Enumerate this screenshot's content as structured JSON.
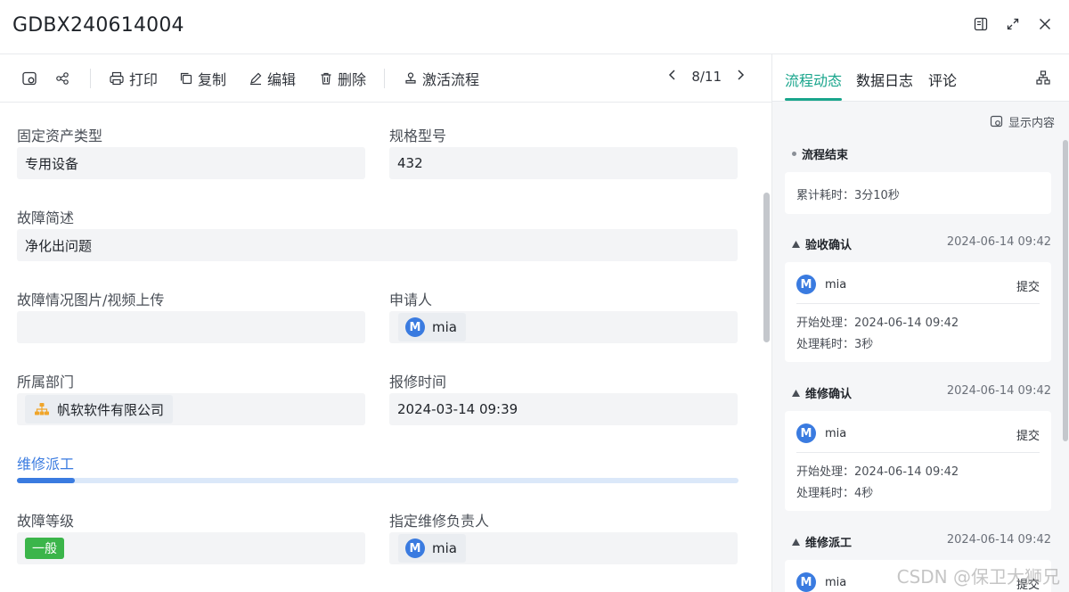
{
  "window": {
    "title": "GDBX240614004",
    "actions": [
      "sidebar-toggle",
      "expand",
      "close"
    ]
  },
  "toolbar": {
    "print": "打印",
    "copy": "复制",
    "edit": "编辑",
    "delete": "删除",
    "activate": "激活流程",
    "pager": "8/11"
  },
  "form": {
    "asset_type": {
      "label": "固定资产类型",
      "value": "专用设备"
    },
    "spec": {
      "label": "规格型号",
      "value": "432"
    },
    "fault_desc": {
      "label": "故障简述",
      "value": "净化出问题"
    },
    "upload": {
      "label": "故障情况图片/视频上传",
      "value": ""
    },
    "applicant": {
      "label": "申请人",
      "avatar": "M",
      "value": "mia"
    },
    "department": {
      "label": "所属部门",
      "value": "帆软软件有限公司"
    },
    "report_time": {
      "label": "报修时间",
      "value": "2024-03-14 09:39"
    },
    "section": {
      "title": "维修派工",
      "progress": 0.08
    },
    "fault_level": {
      "label": "故障等级",
      "value": "一般"
    },
    "assignee": {
      "label": "指定维修负责人",
      "avatar": "M",
      "value": "mia"
    }
  },
  "panel": {
    "tabs": [
      "流程动态",
      "数据日志",
      "评论"
    ],
    "active_tab": 0,
    "show_content": "显示内容",
    "end_node": {
      "title": "流程结束",
      "elapsed": "累计耗时：3分10秒"
    },
    "nodes": [
      {
        "title": "验收确认",
        "date": "2024-06-14 09:42",
        "user": "mia",
        "avatar": "M",
        "action": "提交",
        "start": "开始处理：2024-06-14 09:42",
        "cost": "处理耗时：3秒"
      },
      {
        "title": "维修确认",
        "date": "2024-06-14 09:42",
        "user": "mia",
        "avatar": "M",
        "action": "提交",
        "start": "开始处理：2024-06-14 09:42",
        "cost": "处理耗时：4秒"
      },
      {
        "title": "维修派工",
        "date": "2024-06-14 09:42",
        "user": "mia",
        "avatar": "M",
        "action": "提交"
      }
    ]
  },
  "watermark": "CSDN @保卫大狮兄",
  "colors": {
    "accent_green": "#19a58c",
    "accent_blue": "#3a7be0",
    "tag_green": "#3bb54a"
  }
}
